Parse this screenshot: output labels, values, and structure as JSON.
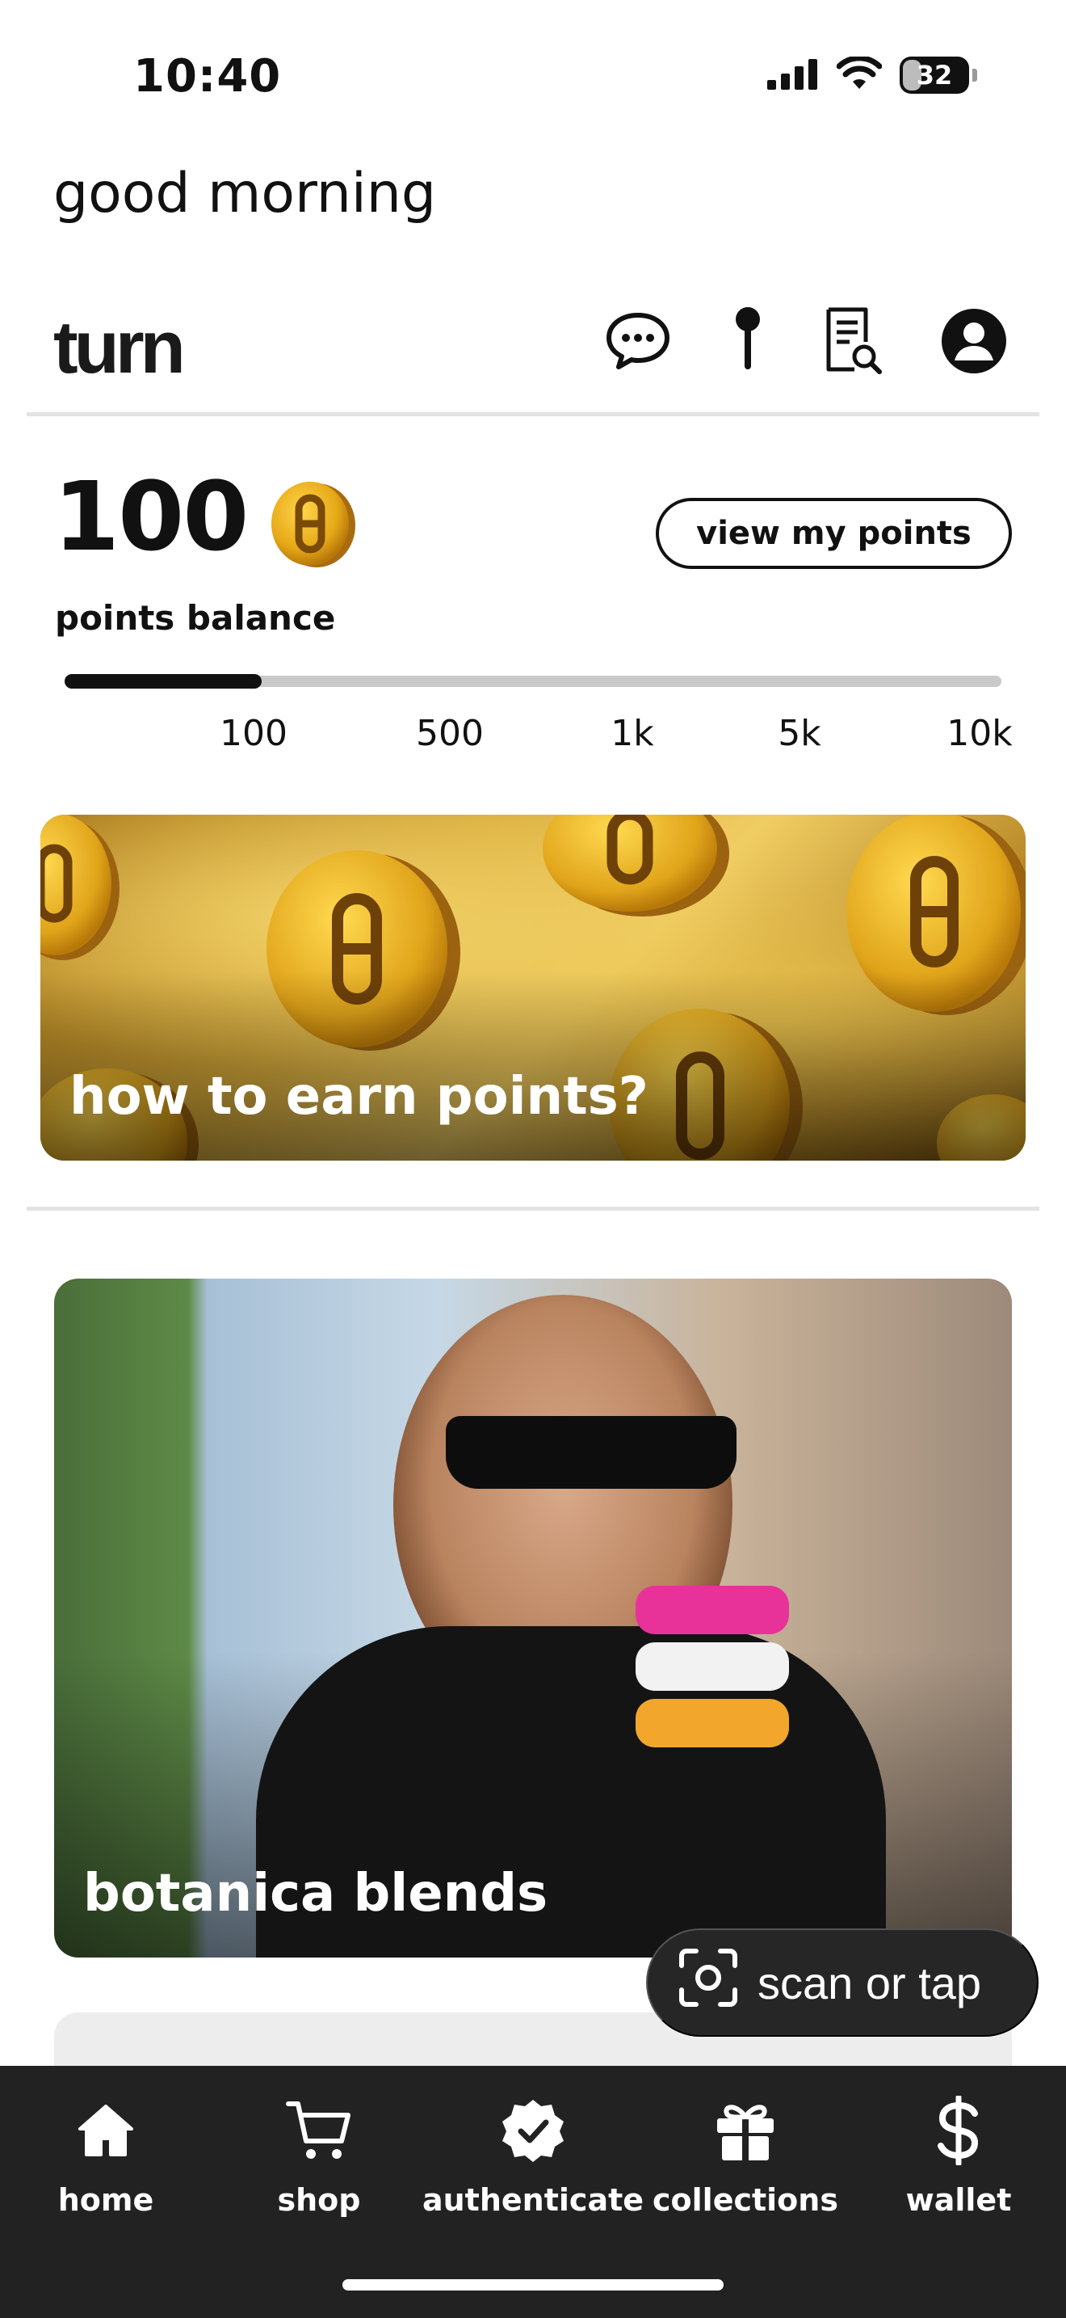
{
  "status_bar": {
    "time": "10:40",
    "battery": "32",
    "battery_level": 0.32
  },
  "greeting": "good morning",
  "header": {
    "logo": "turn",
    "icons": [
      "chat-bubble-icon",
      "location-pin-icon",
      "receipt-search-icon",
      "account-icon"
    ]
  },
  "points": {
    "value": "100",
    "label": "points balance",
    "view_button": "view my points",
    "progress": 0.21,
    "ticks": [
      "100",
      "500",
      "1k",
      "5k",
      "10k"
    ]
  },
  "banners": {
    "earn": {
      "title": "how to earn points?"
    },
    "botanica": {
      "title": "botanica blends"
    }
  },
  "scan_button": {
    "label": "scan or tap"
  },
  "nav": {
    "items": [
      {
        "label": "home",
        "icon": "home-icon"
      },
      {
        "label": "shop",
        "icon": "cart-icon"
      },
      {
        "label": "authenticate",
        "icon": "verified-badge-icon"
      },
      {
        "label": "collections",
        "icon": "gift-icon"
      },
      {
        "label": "wallet",
        "icon": "dollar-icon"
      }
    ]
  },
  "colors": {
    "nav_background": "#222222",
    "coin_gold": "#e8b020",
    "accent_black": "#111111"
  }
}
